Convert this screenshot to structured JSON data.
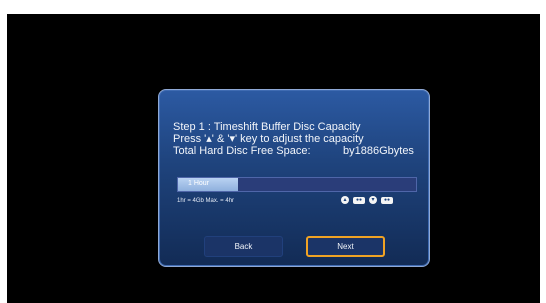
{
  "dialog": {
    "line1": "Step 1 : Timeshift Buffer Disc Capacity",
    "line2": "Press '▴' & '▾' key to adjust the capacity",
    "line3_label": "Total Hard Disc Free Space:",
    "line3_value": "by1886Gbytes"
  },
  "capacity_bar": {
    "label": "1 Hour",
    "fill_fraction": 0.25
  },
  "note": "1hr = 4Gb  Max. = 4hr",
  "keys": [
    {
      "symbol": "▴",
      "icon": "up-key-icon"
    },
    {
      "symbol": "●●",
      "icon": "plus-key-icon"
    },
    {
      "symbol": "▾",
      "icon": "down-key-icon"
    },
    {
      "symbol": "●●",
      "icon": "minus-key-icon"
    }
  ],
  "buttons": {
    "back": "Back",
    "next": "Next"
  },
  "colors": {
    "accent_focus": "#f0a324",
    "dialog_top": "#2c5aa3",
    "dialog_bottom": "#122b55"
  }
}
